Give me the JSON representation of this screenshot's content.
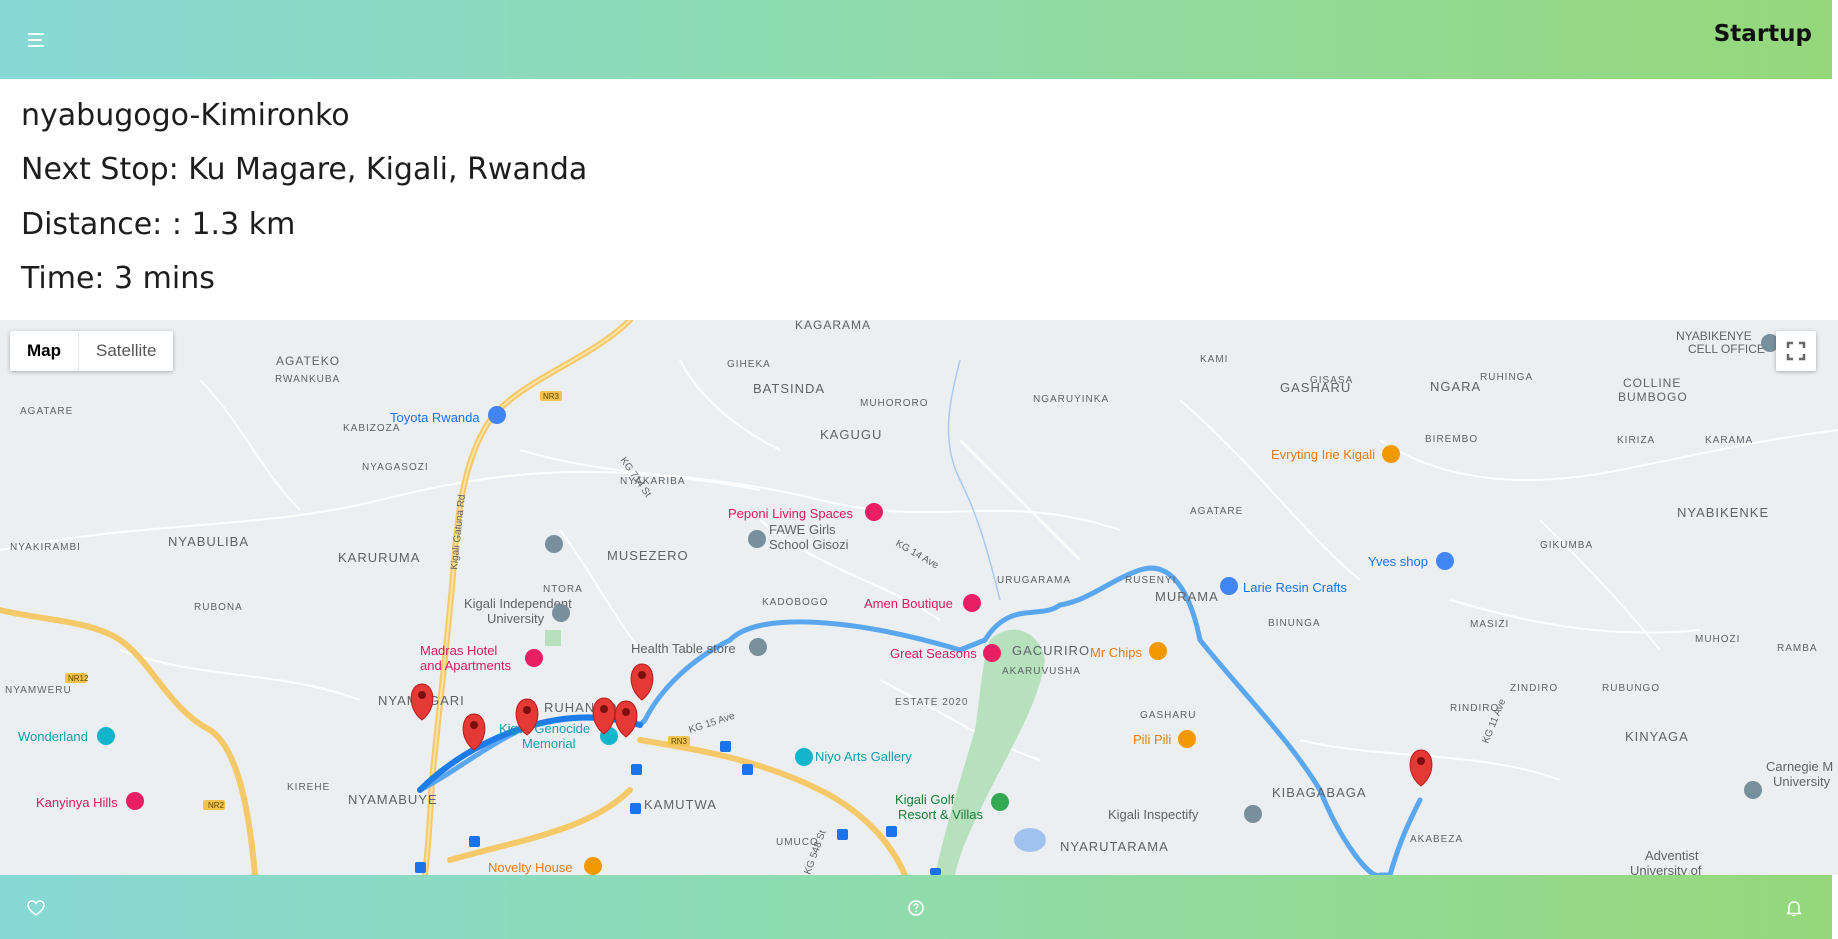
{
  "header": {
    "brand": "Startup",
    "menu_icon": "hamburger-menu-icon"
  },
  "route": {
    "name": "nyabugogo-Kimironko",
    "next_stop": "Next Stop: Ku Magare, Kigali, Rwanda",
    "distance": "Distance: : 1.3 km",
    "time": "Time: 3 mins"
  },
  "map": {
    "type_control": {
      "map_label": "Map",
      "satellite_label": "Satellite"
    },
    "fullscreen_icon": "fullscreen-icon",
    "route_color": "#4a9cf0",
    "marker_color": "#e53935",
    "areas": [
      "KAGARAMA",
      "AGATEKO",
      "RWANKUBA",
      "GIHEKA",
      "BATSINDA",
      "MUHORORO",
      "KAMI",
      "GASHARU",
      "GISASA",
      "NGARA",
      "RUHINGA",
      "COLLINE BUMBOGO",
      "AGATARE",
      "KABIZOZA",
      "KAGUGU",
      "NGARUYINKA",
      "BIREMBO",
      "KIRIZA",
      "KARAMA",
      "NYAGASOZI",
      "NYAKARIBA",
      "NYAKIRAMBI",
      "NYABULIBA",
      "KARURUMA",
      "MUSEZERO",
      "AGATARE",
      "NYABIKENKE",
      "RUSENYI",
      "MURAMA",
      "GIKUMBA",
      "RUBONA",
      "NTORA",
      "KADOBOGO",
      "URUGARAMA",
      "BINUNGA",
      "MASIZI",
      "MUHOZI",
      "RAMBA",
      "GACURIRO",
      "AKARUVUSHA",
      "NYAMWERU",
      "NYAMUGARI",
      "RUHANGO",
      "ESTATE 2020",
      "ZINDIRO",
      "RUBUNGO",
      "GASHARU",
      "RINDIRO",
      "KINYAGA",
      "KIREHE",
      "NYAMABUYE",
      "KAMUTWA",
      "KIBAGABAGA",
      "UMUCO",
      "NYARUTARAMA",
      "AKABEZA"
    ],
    "pois": [
      "Toyota Rwanda",
      "Peponi Living Spaces",
      "FAWE Girls School Gisozi",
      "Evryting Irie Kigali",
      "Yves shop",
      "Larie Resin Crafts",
      "Kigali Independent University",
      "Health Table store",
      "Amen Boutique",
      "Great Seasons",
      "Mr Chips",
      "Madras Hotel and Apartments",
      "Wonderland",
      "Kigali Genocide Memorial",
      "Niyo Arts Gallery",
      "Pili Pili",
      "Kigali Golf Resort & Villas",
      "Kigali Inspectify",
      "Kanyinya Hills",
      "Novelty House",
      "Carnegie Mellon University",
      "Adventist University of",
      "NYABIKENYE CELL OFFICE"
    ],
    "roads": [
      "NR3",
      "RN3",
      "NR12",
      "NR2",
      "Kigali Gatuna Rd",
      "KG 714 St",
      "KG 14 Ave",
      "KG 15 Ave",
      "KG 548 St",
      "KG 11 Ave"
    ]
  },
  "footer": {
    "favorite_icon": "heart-icon",
    "help_icon": "help-icon",
    "notifications_icon": "bell-icon"
  }
}
